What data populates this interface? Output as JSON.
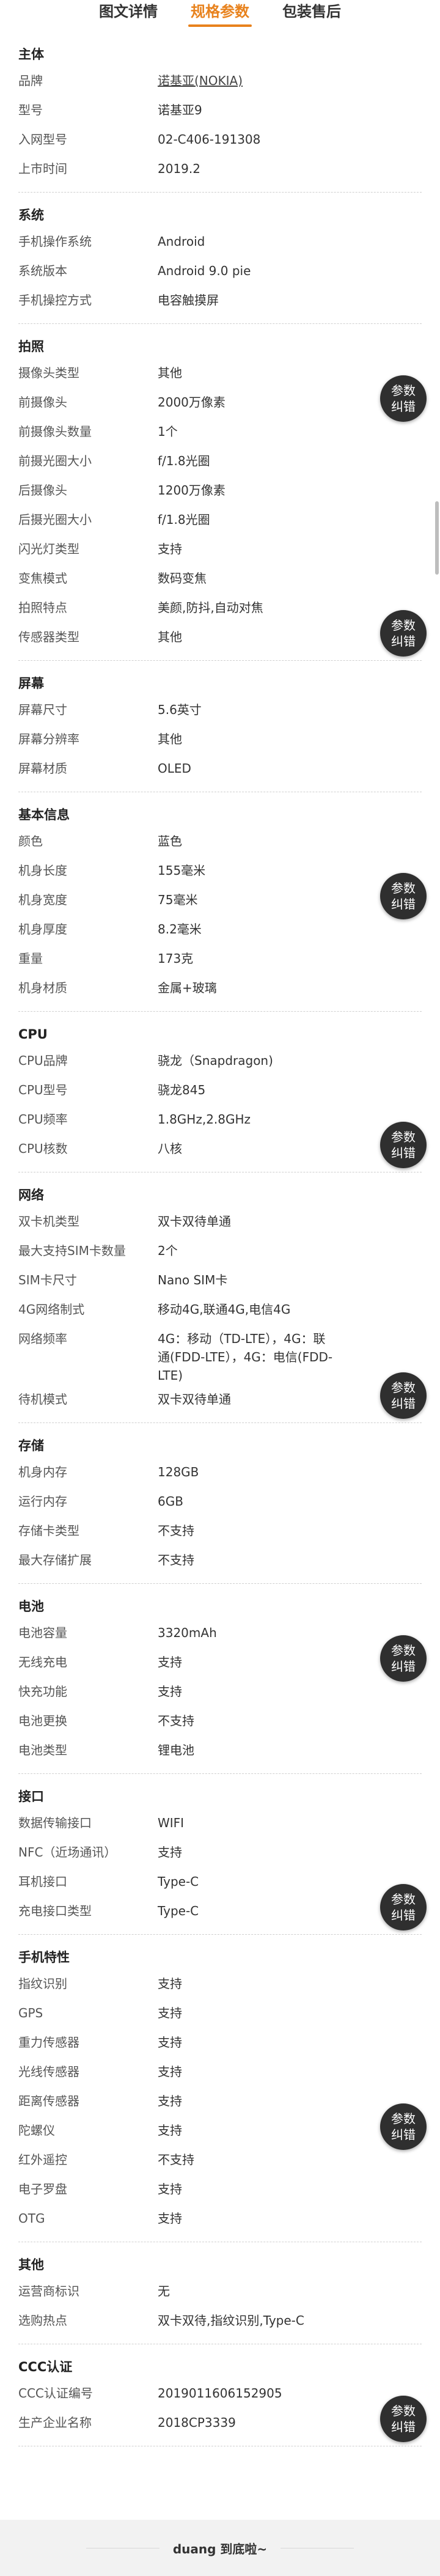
{
  "tabs": [
    "图文详情",
    "规格参数",
    "包装售后"
  ],
  "active_tab": 1,
  "fab": {
    "line1": "参数",
    "line2": "纠错"
  },
  "sections": [
    {
      "title": "主体",
      "rows": [
        {
          "label": "品牌",
          "value": "诺基亚(NOKIA)",
          "link": true
        },
        {
          "label": "型号",
          "value": "诺基亚9"
        },
        {
          "label": "入网型号",
          "value": "02-C406-191308"
        },
        {
          "label": "上市时间",
          "value": "2019.2"
        }
      ]
    },
    {
      "title": "系统",
      "rows": [
        {
          "label": "手机操作系统",
          "value": "Android"
        },
        {
          "label": "系统版本",
          "value": "Android 9.0 pie"
        },
        {
          "label": "手机操控方式",
          "value": "电容触摸屏"
        }
      ]
    },
    {
      "title": "拍照",
      "rows": [
        {
          "label": "摄像头类型",
          "value": "其他"
        },
        {
          "label": "前摄像头",
          "value": "2000万像素"
        },
        {
          "label": "前摄像头数量",
          "value": "1个"
        },
        {
          "label": "前摄光圈大小",
          "value": "f/1.8光圈"
        },
        {
          "label": "后摄像头",
          "value": "1200万像素"
        },
        {
          "label": "后摄光圈大小",
          "value": "f/1.8光圈"
        },
        {
          "label": "闪光灯类型",
          "value": "支持"
        },
        {
          "label": "变焦模式",
          "value": "数码变焦"
        },
        {
          "label": "拍照特点",
          "value": "美颜,防抖,自动对焦"
        },
        {
          "label": "传感器类型",
          "value": "其他"
        }
      ]
    },
    {
      "title": "屏幕",
      "rows": [
        {
          "label": "屏幕尺寸",
          "value": "5.6英寸"
        },
        {
          "label": "屏幕分辨率",
          "value": "其他"
        },
        {
          "label": "屏幕材质",
          "value": "OLED"
        }
      ]
    },
    {
      "title": "基本信息",
      "rows": [
        {
          "label": "颜色",
          "value": "蓝色"
        },
        {
          "label": "机身长度",
          "value": "155毫米"
        },
        {
          "label": "机身宽度",
          "value": "75毫米"
        },
        {
          "label": "机身厚度",
          "value": "8.2毫米"
        },
        {
          "label": "重量",
          "value": "173克"
        },
        {
          "label": "机身材质",
          "value": "金属+玻璃"
        }
      ]
    },
    {
      "title": "CPU",
      "rows": [
        {
          "label": "CPU品牌",
          "value": "骁龙（Snapdragon)"
        },
        {
          "label": "CPU型号",
          "value": "骁龙845"
        },
        {
          "label": "CPU频率",
          "value": "1.8GHz,2.8GHz"
        },
        {
          "label": "CPU核数",
          "value": "八核"
        }
      ]
    },
    {
      "title": "网络",
      "rows": [
        {
          "label": "双卡机类型",
          "value": "双卡双待单通"
        },
        {
          "label": "最大支持SIM卡数量",
          "value": "2个"
        },
        {
          "label": "SIM卡尺寸",
          "value": "Nano SIM卡"
        },
        {
          "label": "4G网络制式",
          "value": "移动4G,联通4G,电信4G"
        },
        {
          "label": "网络频率",
          "value": "4G：移动（TD-LTE），4G：联通(FDD-LTE），4G：电信(FDD-LTE)"
        },
        {
          "label": "待机模式",
          "value": "双卡双待单通"
        }
      ]
    },
    {
      "title": "存储",
      "rows": [
        {
          "label": "机身内存",
          "value": "128GB"
        },
        {
          "label": "运行内存",
          "value": "6GB"
        },
        {
          "label": "存储卡类型",
          "value": "不支持"
        },
        {
          "label": "最大存储扩展",
          "value": "不支持"
        }
      ]
    },
    {
      "title": "电池",
      "rows": [
        {
          "label": "电池容量",
          "value": "3320mAh"
        },
        {
          "label": "无线充电",
          "value": "支持"
        },
        {
          "label": "快充功能",
          "value": "支持"
        },
        {
          "label": "电池更换",
          "value": "不支持"
        },
        {
          "label": "电池类型",
          "value": "锂电池"
        }
      ]
    },
    {
      "title": "接口",
      "rows": [
        {
          "label": "数据传输接口",
          "value": "WIFI"
        },
        {
          "label": "NFC（近场通讯）",
          "value": "支持"
        },
        {
          "label": "耳机接口",
          "value": "Type-C"
        },
        {
          "label": "充电接口类型",
          "value": "Type-C"
        }
      ]
    },
    {
      "title": "手机特性",
      "rows": [
        {
          "label": "指纹识别",
          "value": "支持"
        },
        {
          "label": "GPS",
          "value": "支持"
        },
        {
          "label": "重力传感器",
          "value": "支持"
        },
        {
          "label": "光线传感器",
          "value": "支持"
        },
        {
          "label": "距离传感器",
          "value": "支持"
        },
        {
          "label": "陀螺仪",
          "value": "支持"
        },
        {
          "label": "红外遥控",
          "value": "不支持"
        },
        {
          "label": "电子罗盘",
          "value": "支持"
        },
        {
          "label": "OTG",
          "value": "支持"
        }
      ]
    },
    {
      "title": "其他",
      "rows": [
        {
          "label": "运营商标识",
          "value": "无"
        },
        {
          "label": "选购热点",
          "value": "双卡双待,指纹识别,Type-C"
        }
      ]
    },
    {
      "title": "CCC认证",
      "rows": [
        {
          "label": "CCC认证编号",
          "value": "2019011606152905"
        },
        {
          "label": "生产企业名称",
          "value": "2018CP3339"
        }
      ]
    }
  ],
  "footer": {
    "text": "duang 到底啦~"
  }
}
